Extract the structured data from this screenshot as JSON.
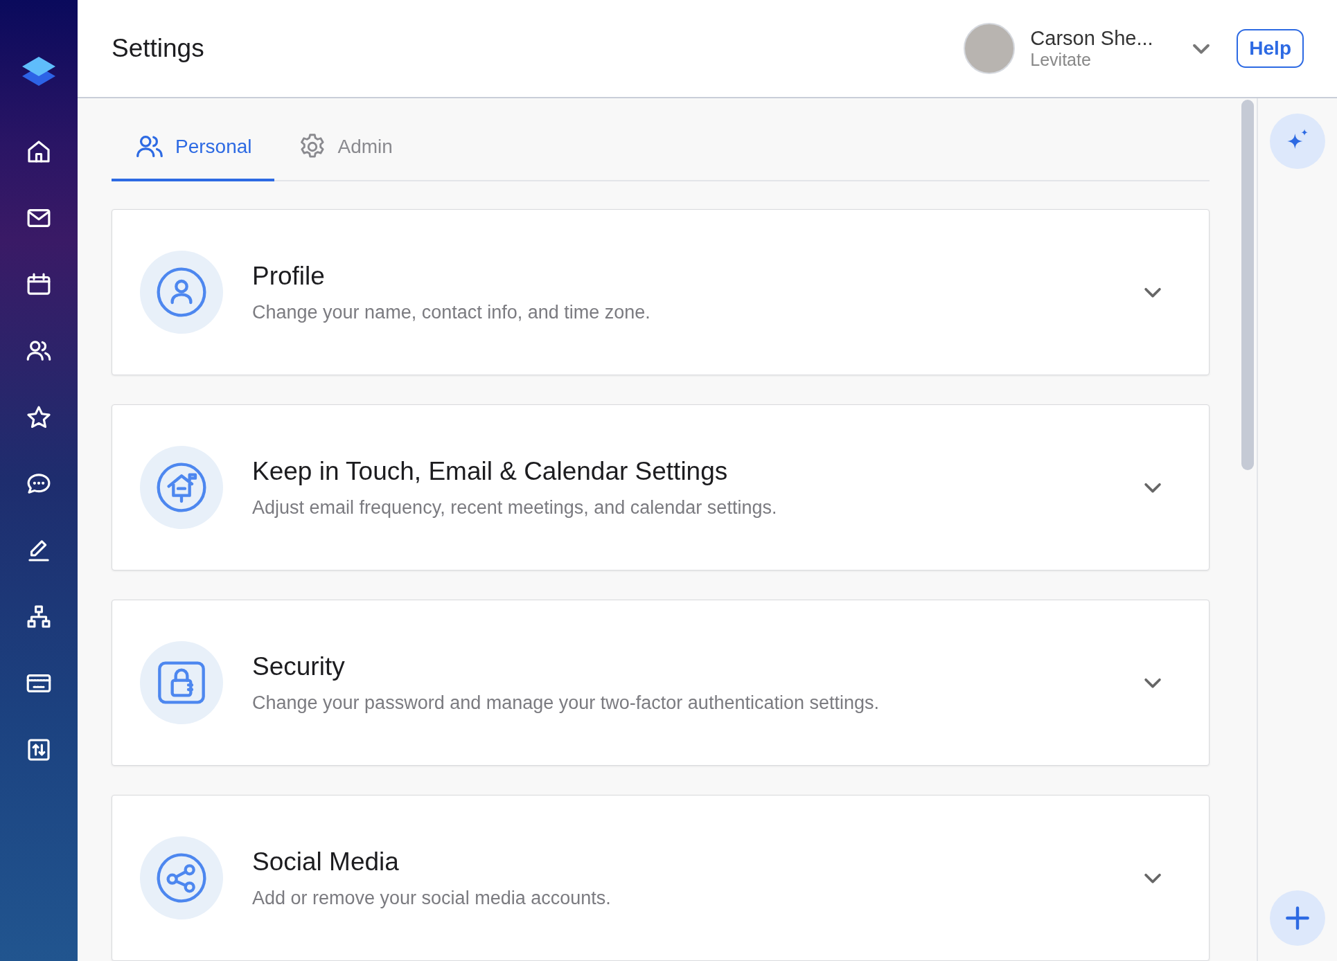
{
  "header": {
    "title": "Settings",
    "user": {
      "name": "Carson She...",
      "organization": "Levitate"
    },
    "help_button": "Help"
  },
  "tabs": [
    {
      "label": "Personal",
      "selected": true
    },
    {
      "label": "Admin",
      "selected": false
    }
  ],
  "cards": [
    {
      "title": "Profile",
      "description": "Change your name, contact info, and time zone."
    },
    {
      "title": "Keep in Touch, Email & Calendar Settings",
      "description": "Adjust email frequency, recent meetings, and calendar settings."
    },
    {
      "title": "Security",
      "description": "Change your password and manage your two-factor authentication settings."
    },
    {
      "title": "Social Media",
      "description": "Add or remove your social media accounts."
    }
  ]
}
